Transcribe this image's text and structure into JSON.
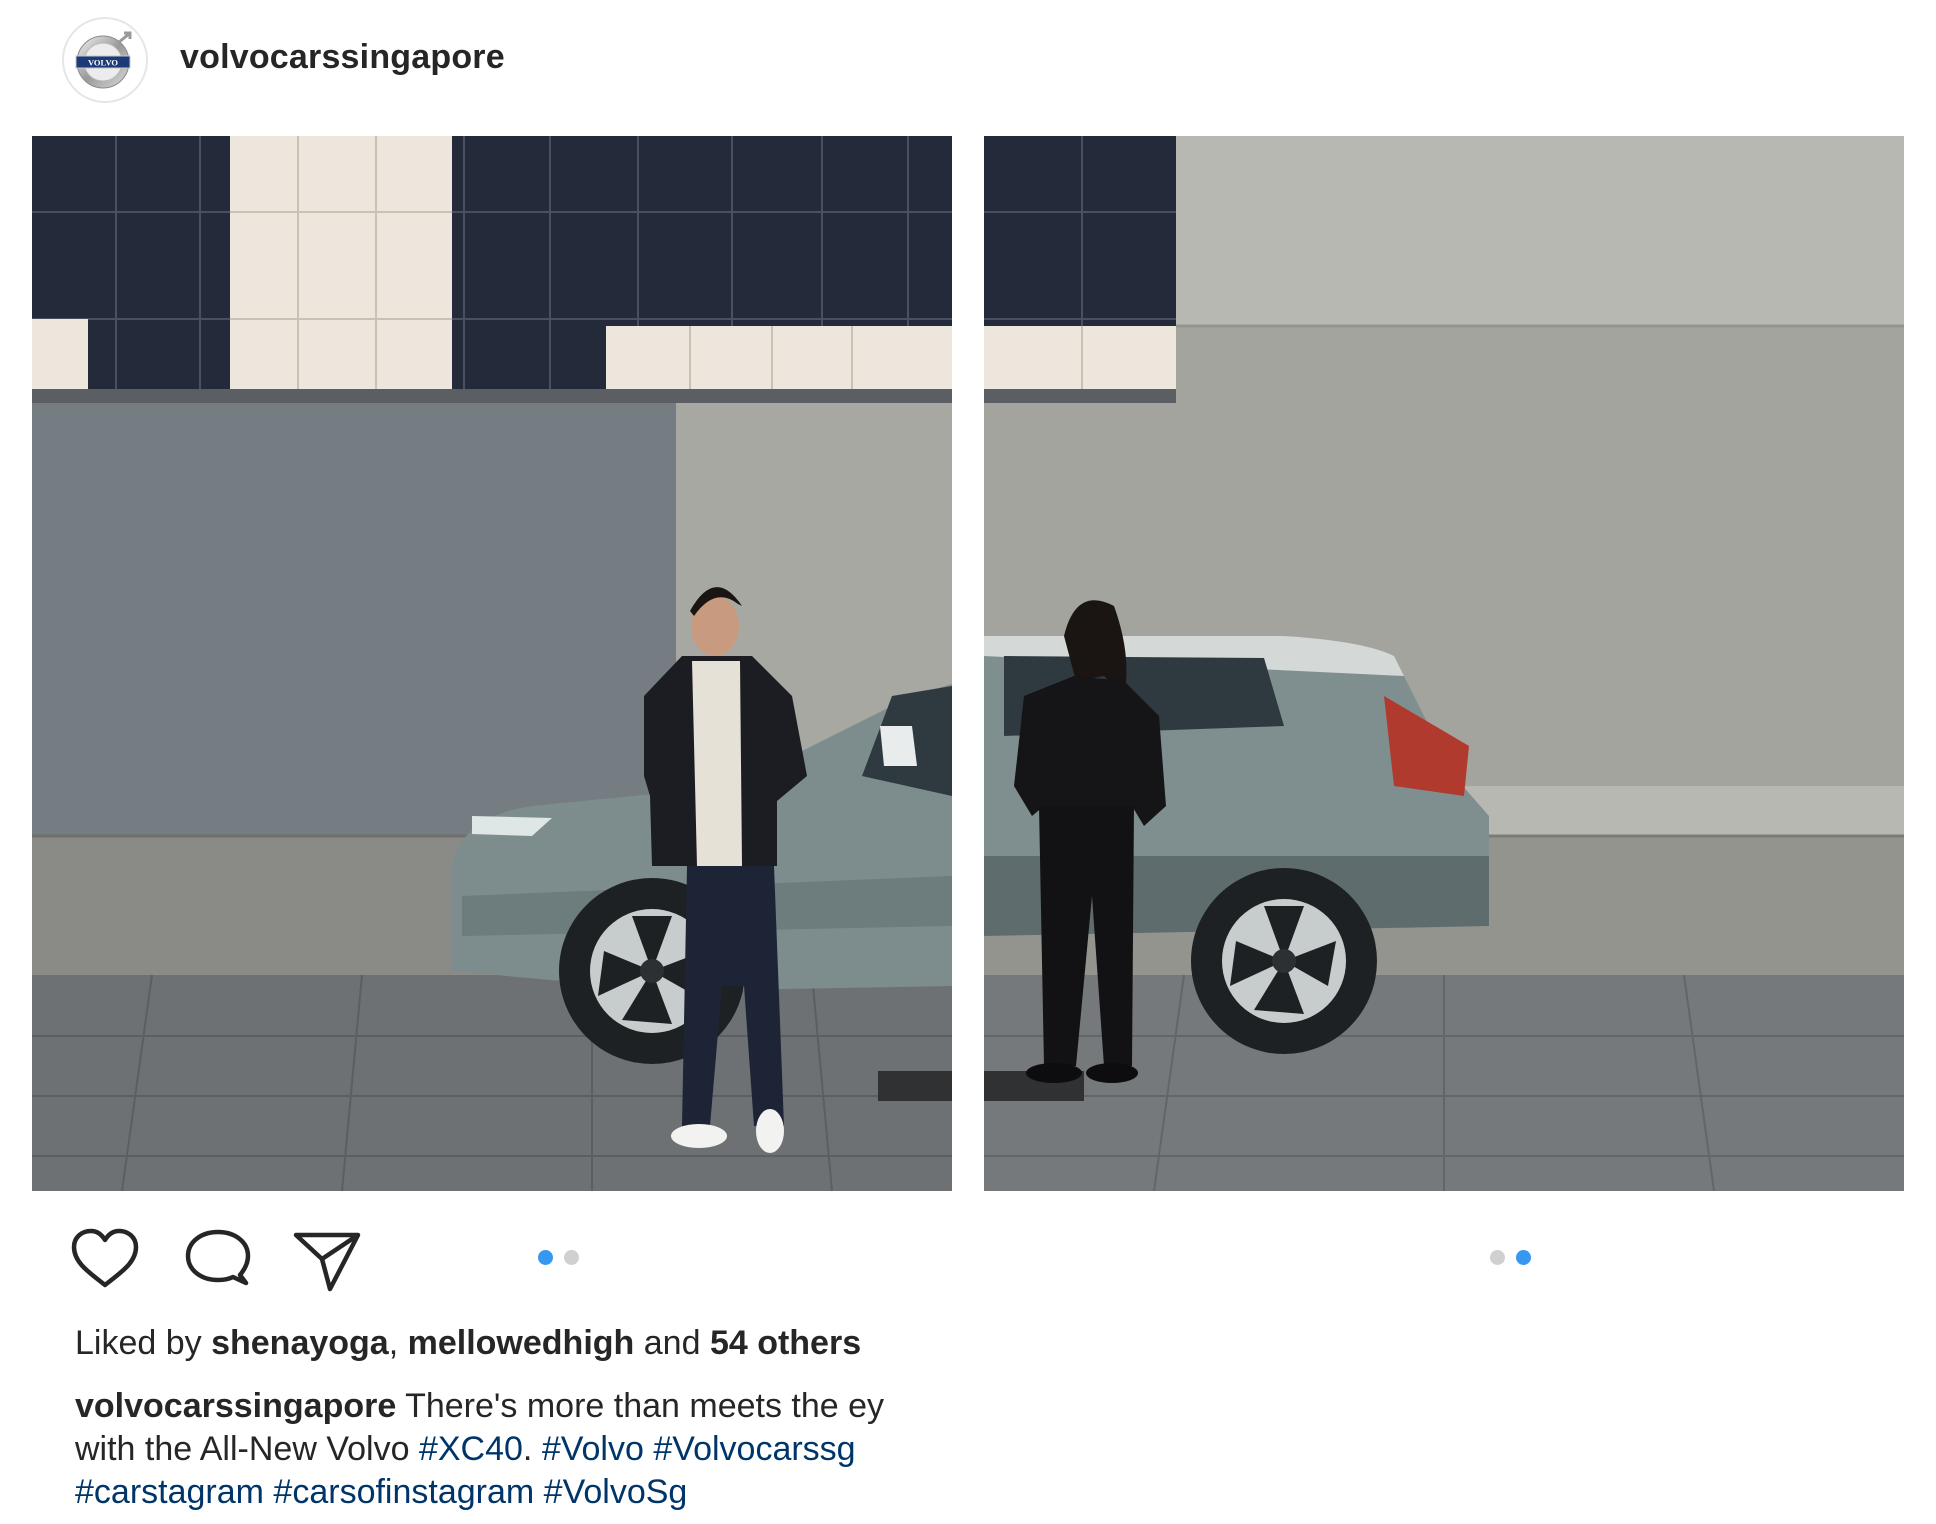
{
  "post": {
    "username": "volvocarssingapore",
    "avatar_logo_text": "VOLVO"
  },
  "photos": [
    {
      "slide": 1,
      "description_icon": "volvo-xc40-man-photo"
    },
    {
      "slide": 2,
      "description_icon": "volvo-xc40-woman-photo"
    }
  ],
  "carousel": {
    "total_slides": 2,
    "left_active_index": 1,
    "right_active_index": 2,
    "active_color": "#3897f0",
    "inactive_color": "#d0d0d0"
  },
  "likes": {
    "prefix": "Liked by ",
    "user1": "shenayoga",
    "separator": ", ",
    "user2": "mellowedhigh",
    "conjunction": " and ",
    "others": "54 others"
  },
  "caption": {
    "username": "volvocarssingapore",
    "line1_text": " There's more than meets the ey",
    "line2_text": "with the All-New Volvo ",
    "line2_tag1": "#XC40",
    "line2_mid": ". ",
    "line2_tag2": "#Volvo",
    "line2_space": " ",
    "line2_tag3": "#Volvocarssg",
    "line3_tag1": "#carstagram",
    "line3_tag2": "#carsofinstagram",
    "line3_tag3": "#VolvoSg",
    "link_color": "#003569"
  }
}
